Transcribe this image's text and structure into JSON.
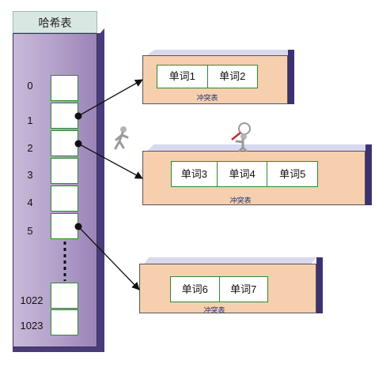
{
  "hash_table": {
    "title": "哈希表",
    "indices": [
      "0",
      "1",
      "2",
      "3",
      "4",
      "5",
      "1022",
      "1023"
    ]
  },
  "conflict_tables": [
    {
      "words": [
        "单词1",
        "单词2"
      ],
      "label": "冲突表"
    },
    {
      "words": [
        "单词3",
        "单词4",
        "单词5"
      ],
      "label": "冲突表"
    },
    {
      "words": [
        "单词6",
        "单词7"
      ],
      "label": "冲突表"
    }
  ],
  "colors": {
    "column_purple": "#b6a4cc",
    "column_dark": "#4a3c78",
    "box_peach": "#f5cfae",
    "slot_border": "#2e8b2e"
  }
}
